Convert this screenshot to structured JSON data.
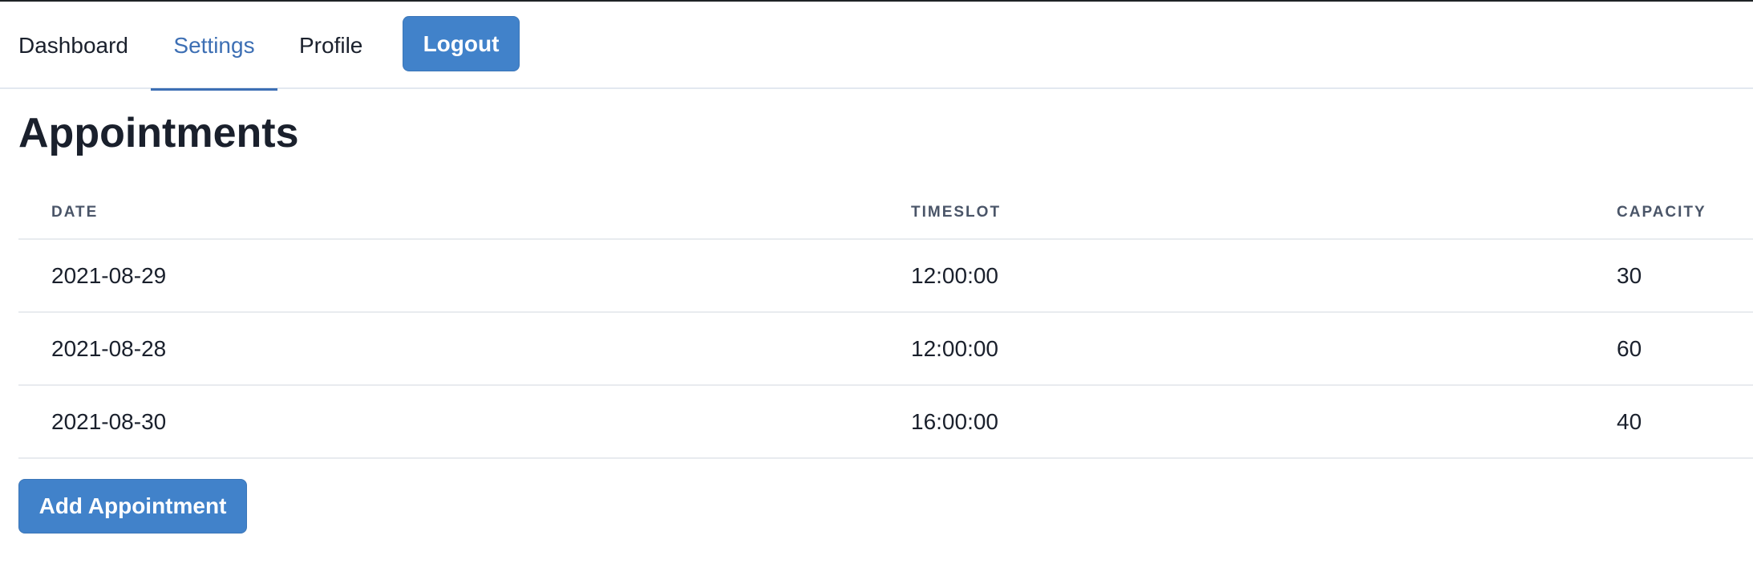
{
  "nav": {
    "tabs": [
      {
        "label": "Dashboard",
        "active": false
      },
      {
        "label": "Settings",
        "active": true
      },
      {
        "label": "Profile",
        "active": false
      }
    ],
    "logout_label": "Logout"
  },
  "page": {
    "title": "Appointments"
  },
  "table": {
    "headers": [
      "DATE",
      "TIMESLOT",
      "CAPACITY"
    ],
    "rows": [
      [
        "2021-08-29",
        "12:00:00",
        "30"
      ],
      [
        "2021-08-28",
        "12:00:00",
        "60"
      ],
      [
        "2021-08-30",
        "16:00:00",
        "40"
      ]
    ]
  },
  "actions": {
    "add_label": "Add Appointment"
  },
  "colors": {
    "accent": "#3d6fb4",
    "button": "#4182ca"
  }
}
